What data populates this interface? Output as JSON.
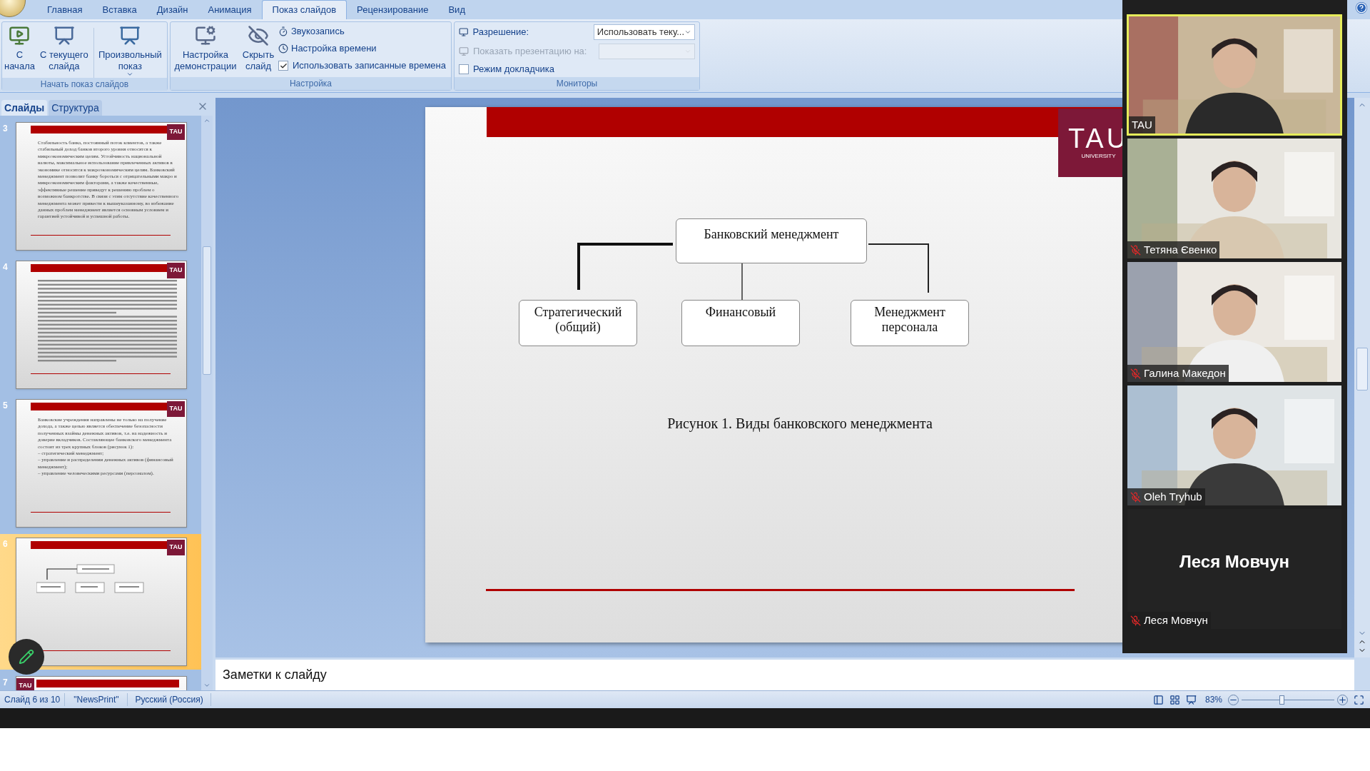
{
  "ribbon": {
    "tabs": [
      {
        "label": "Главная",
        "selected": false
      },
      {
        "label": "Вставка",
        "selected": false
      },
      {
        "label": "Дизайн",
        "selected": false
      },
      {
        "label": "Анимация",
        "selected": false
      },
      {
        "label": "Показ слайдов",
        "selected": true
      },
      {
        "label": "Рецензирование",
        "selected": false
      },
      {
        "label": "Вид",
        "selected": false
      }
    ],
    "start_group": {
      "title": "Начать показ слайдов",
      "buttons": [
        {
          "label": "С\nначала",
          "dropdown": false
        },
        {
          "label": "С текущего\nслайда",
          "dropdown": false
        },
        {
          "label": "Произвольный\nпоказ",
          "dropdown": true
        }
      ]
    },
    "setup_group": {
      "title": "Настройка",
      "buttons": [
        {
          "label": "Настройка\nдемонстрации"
        },
        {
          "label": "Скрыть\nслайд"
        }
      ],
      "commands": [
        {
          "label": "Звукозапись"
        },
        {
          "label": "Настройка времени"
        }
      ],
      "checkbox": {
        "label": "Использовать записанные времена",
        "checked": true
      }
    },
    "monitors_group": {
      "title": "Мониторы",
      "resolution": {
        "label": "Разрешение:",
        "value": "Использовать теку...",
        "disabled": false
      },
      "show_on": {
        "label": "Показать презентацию на:",
        "disabled": true
      },
      "presenter_view": {
        "label": "Режим докладчика",
        "checked": false
      }
    }
  },
  "left_panel": {
    "tabs": [
      {
        "label": "Слайды",
        "selected": true
      },
      {
        "label": "Структура",
        "selected": false
      }
    ],
    "slides": [
      {
        "number": "3",
        "selected": false,
        "kind": "text",
        "logo": "TAU",
        "text": "Стабильность банка, постоянный поток клиентов, а также стабильный доход банков второго уровня относятся к микроэкономическим целям. Устойчивость национальной валюты, максимальное использование привлеченных активов в экономике относятся к макроэкономическим целям. Банковский менеджмент позволит банку бороться с отрицательными макро и микроэкономическим факторами, а также качественные, эффективные решение приведут к решению проблем о возможном банкротстве. В связи с этим отсутствие качественного менеджмента может привести к вышеуказанному, во избежание данных проблем менеджмент является основным условием и гарантией устойчивой и успешной работы."
      },
      {
        "number": "4",
        "selected": false,
        "kind": "dense_text",
        "logo": "TAU"
      },
      {
        "number": "5",
        "selected": false,
        "kind": "text",
        "logo": "TAU",
        "text": "Банковские учреждения направлены не только на получение дохода, а также целью является обеспечение безопасности полученных взаймы денежных активов, т.е. на надежность и доверие вкладчиков. Составляющее банковского менеджмента состоит из трех крупных блоков (рисунок 1):\n– стратегический менеджмент;\n– управление и распределении денежных активов (финансовый менеджмент);\n– управление человеческими ресурсами (персоналом)."
      },
      {
        "number": "6",
        "selected": true,
        "kind": "diagram",
        "logo": "TAU"
      },
      {
        "number": "7",
        "selected": false,
        "kind": "partial",
        "logo": "TAU"
      }
    ]
  },
  "slide": {
    "logo": {
      "name": "TAU",
      "subtitle": "UNIVERSITY"
    },
    "diagram": {
      "root": "Банковский менеджмент",
      "children": [
        "Стратегический\n(общий)",
        "Финансовый",
        "Менеджмент\nперсонала"
      ]
    },
    "caption": "Рисунок 1. Виды банковского менеджмента"
  },
  "notes": {
    "placeholder": "Заметки к слайду"
  },
  "status_bar": {
    "slide": "Слайд 6 из 10",
    "theme": "\"NewsPrint\"",
    "language": "Русский (Россия)",
    "zoom": {
      "reading": "83%",
      "level": 0.43
    }
  },
  "zoom_panel": {
    "participants": [
      {
        "name": "TAU",
        "kind": "video",
        "muted": false,
        "speaking": true
      },
      {
        "name": "Тетяна Євенко",
        "kind": "video",
        "muted": true,
        "speaking": false
      },
      {
        "name": "Галина Македон",
        "kind": "video",
        "muted": true,
        "speaking": false
      },
      {
        "name": "Oleh Tryhub",
        "kind": "video",
        "muted": true,
        "speaking": false
      },
      {
        "name": "Леся Мовчун",
        "kind": "name_card",
        "display_name": "Леся Мовчун",
        "muted": true,
        "speaking": false
      }
    ]
  }
}
